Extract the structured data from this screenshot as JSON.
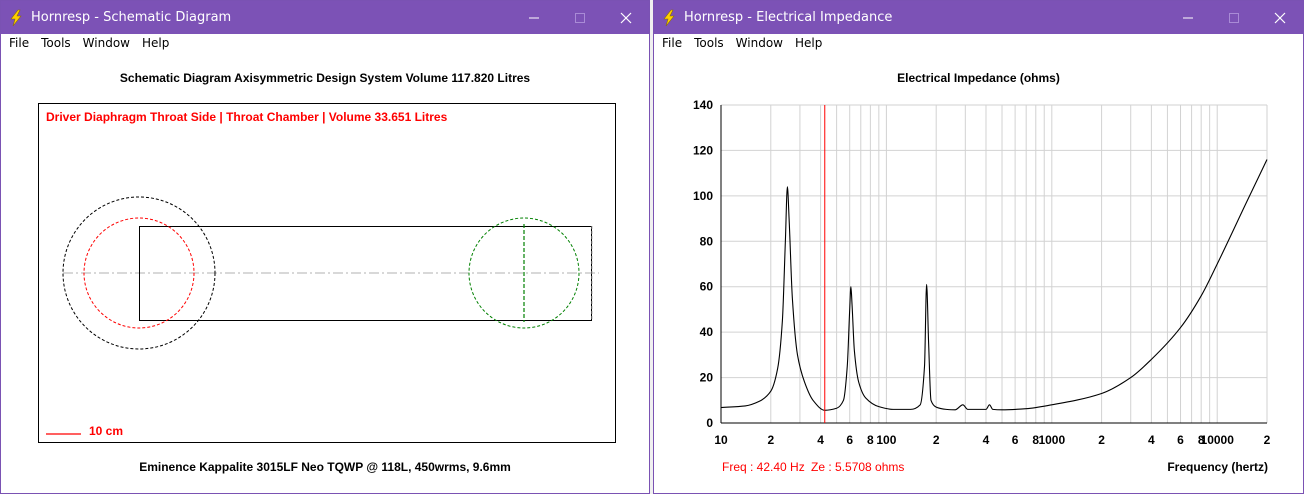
{
  "colors": {
    "titlebar": "#7c52b6",
    "red_annotation": "#ff0000",
    "green_circle": "#008000",
    "grid": "#c8c8c8"
  },
  "menus": [
    "File",
    "Tools",
    "Window",
    "Help"
  ],
  "schematic": {
    "window_title": "Hornresp - Schematic Diagram",
    "heading": "Schematic Diagram   Axisymmetric Design   System Volume 117.820 Litres",
    "label": "Driver Diaphragm Throat Side | Throat Chamber | Volume 33.651 Litres",
    "scale_label": "10 cm",
    "footer": "Eminence Kappalite 3015LF Neo TQWP @ 118L, 450wrms, 9.6mm"
  },
  "impedance": {
    "window_title": "Hornresp - Electrical Impedance",
    "heading": "Electrical Impedance (ohms)",
    "freq_readout": "Freq : 42.40 Hz",
    "ze_readout": "Ze : 5.5708 ohms",
    "freq_axis_label": "Frequency (hertz)"
  },
  "chart_data": {
    "type": "line",
    "title": "Electrical Impedance (ohms)",
    "xlabel": "Frequency (hertz)",
    "ylabel": "",
    "x_scale": "log",
    "xlim": [
      10,
      20000
    ],
    "ylim": [
      0,
      140
    ],
    "y_ticks": [
      "0",
      "20",
      "40",
      "60",
      "80",
      "100",
      "120",
      "140"
    ],
    "x_tick_labels": [
      {
        "f": 10,
        "label": "10"
      },
      {
        "f": 20,
        "label": "2"
      },
      {
        "f": 40,
        "label": "4"
      },
      {
        "f": 60,
        "label": "6"
      },
      {
        "f": 80,
        "label": "8"
      },
      {
        "f": 100,
        "label": "100"
      },
      {
        "f": 200,
        "label": "2"
      },
      {
        "f": 400,
        "label": "4"
      },
      {
        "f": 600,
        "label": "6"
      },
      {
        "f": 800,
        "label": "8"
      },
      {
        "f": 1000,
        "label": "1000"
      },
      {
        "f": 2000,
        "label": "2"
      },
      {
        "f": 4000,
        "label": "4"
      },
      {
        "f": 6000,
        "label": "6"
      },
      {
        "f": 8000,
        "label": "8"
      },
      {
        "f": 10000,
        "label": "10000"
      },
      {
        "f": 20000,
        "label": "2"
      }
    ],
    "grid": true,
    "cursor_x": 42.4,
    "series": [
      {
        "points": [
          [
            10,
            6.8
          ],
          [
            14,
            7.5
          ],
          [
            17,
            9.5
          ],
          [
            20,
            14
          ],
          [
            22,
            24
          ],
          [
            23.5,
            45
          ],
          [
            24.5,
            80
          ],
          [
            25.2,
            104
          ],
          [
            25.8,
            90
          ],
          [
            27,
            55
          ],
          [
            29,
            30
          ],
          [
            32,
            18
          ],
          [
            36,
            10
          ],
          [
            42.4,
            5.6
          ],
          [
            50,
            6.5
          ],
          [
            55,
            10
          ],
          [
            58,
            25
          ],
          [
            60,
            50
          ],
          [
            61,
            60
          ],
          [
            62,
            52
          ],
          [
            64,
            32
          ],
          [
            68,
            18
          ],
          [
            75,
            11
          ],
          [
            90,
            7.2
          ],
          [
            110,
            6
          ],
          [
            140,
            6
          ],
          [
            160,
            8
          ],
          [
            170,
            25
          ],
          [
            175,
            61
          ],
          [
            180,
            35
          ],
          [
            186,
            10
          ],
          [
            200,
            7
          ],
          [
            230,
            6
          ],
          [
            260,
            5.8
          ],
          [
            290,
            8
          ],
          [
            310,
            6
          ],
          [
            400,
            6
          ],
          [
            420,
            8
          ],
          [
            440,
            6
          ],
          [
            500,
            5.8
          ],
          [
            700,
            6.3
          ],
          [
            1000,
            8
          ],
          [
            2000,
            13
          ],
          [
            3000,
            20
          ],
          [
            4000,
            28
          ],
          [
            6000,
            42
          ],
          [
            8000,
            56
          ],
          [
            10000,
            70
          ],
          [
            15000,
            97
          ],
          [
            20000,
            116
          ]
        ]
      }
    ]
  }
}
